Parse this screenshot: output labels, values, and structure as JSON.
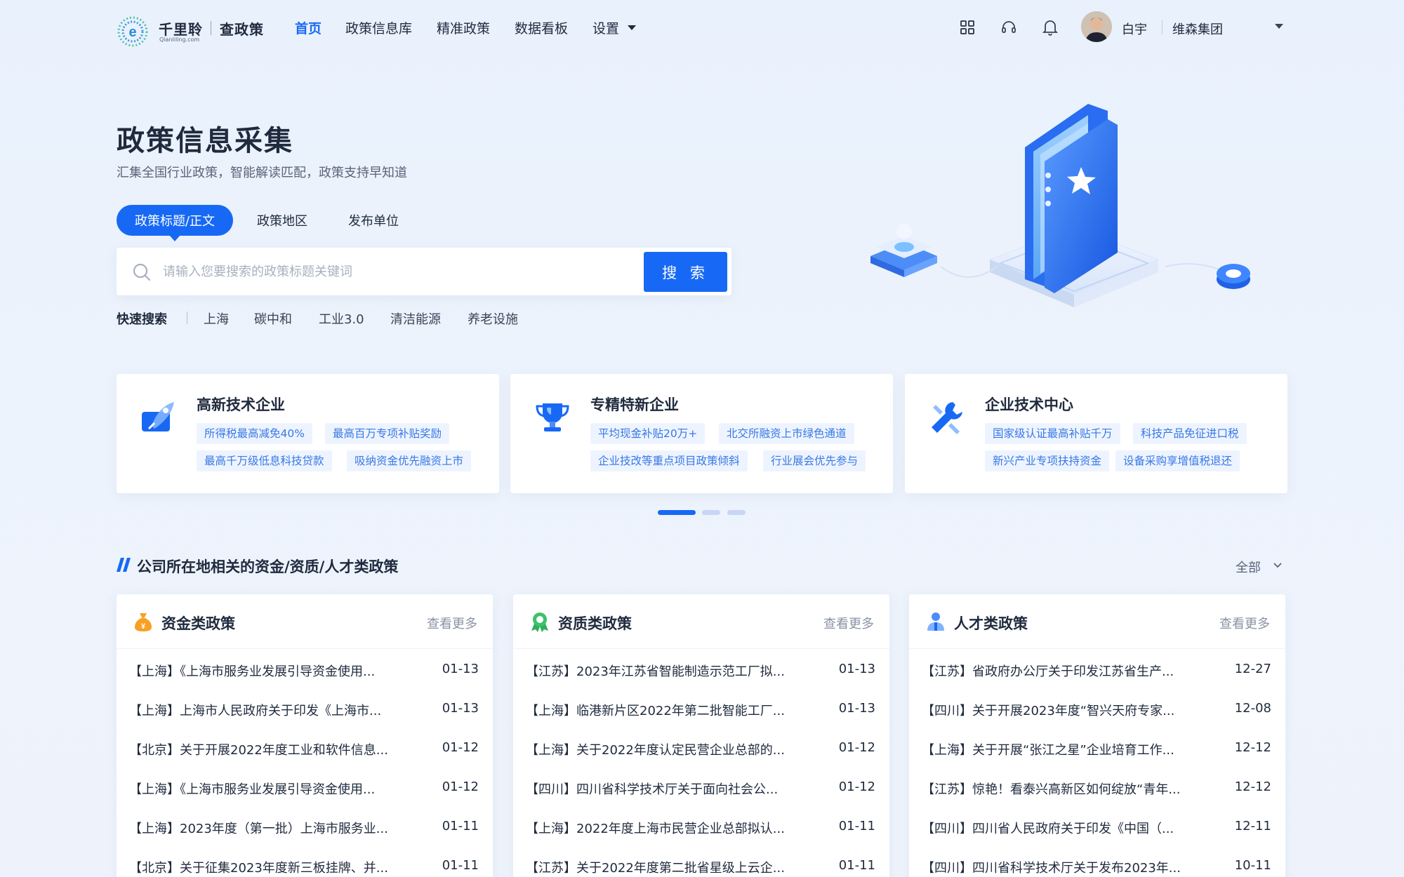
{
  "brand": {
    "name_cn": "千里聆",
    "name_en": "Qianliling.com",
    "product": "查政策"
  },
  "nav": {
    "items": [
      {
        "label": "首页",
        "active": true
      },
      {
        "label": "政策信息库",
        "active": false
      },
      {
        "label": "精准政策",
        "active": false
      },
      {
        "label": "数据看板",
        "active": false
      },
      {
        "label": "设置",
        "active": false
      }
    ]
  },
  "header": {
    "icons": [
      "apps-grid-icon",
      "headset-icon",
      "bell-icon"
    ],
    "user_name": "白宇",
    "org_name": "维森集团"
  },
  "hero": {
    "title": "政策信息采集",
    "subtitle": "汇集全国行业政策，智能解读匹配，政策支持早知道",
    "tabs": [
      {
        "label": "政策标题/正文",
        "active": true
      },
      {
        "label": "政策地区",
        "active": false
      },
      {
        "label": "发布单位",
        "active": false
      }
    ],
    "search_placeholder": "请输入您要搜索的政策标题关键词",
    "search_value": "",
    "search_button": "搜 索",
    "quick_label": "快速搜索",
    "quick_items": [
      "上海",
      "碳中和",
      "工业3.0",
      "清洁能源",
      "养老设施"
    ]
  },
  "feature_cards": [
    {
      "title": "高新技术企业",
      "icon": "rocket-icon",
      "tags": [
        "所得税最高减免40%",
        "最高百万专项补贴奖励",
        "最高千万级低息科技贷款",
        "吸纳资金优先融资上市"
      ]
    },
    {
      "title": "专精特新企业",
      "icon": "trophy-icon",
      "tags": [
        "平均现金补贴20万+",
        "北交所融资上市绿色通道",
        "企业技改等重点项目政策倾斜",
        "行业展会优先参与"
      ]
    },
    {
      "title": "企业技术中心",
      "icon": "wrench-tools-icon",
      "tags": [
        "国家级认证最高补贴千万",
        "科技产品免征进口税",
        "新兴产业专项扶持资金",
        "设备采购享增值税退还"
      ]
    }
  ],
  "carousel": {
    "count": 3,
    "active_index": 0
  },
  "section": {
    "title": "公司所在地相关的资金/资质/人才类政策",
    "filter_label": "全部"
  },
  "policy_cards": [
    {
      "title": "资金类政策",
      "icon": "money-bag-icon",
      "more_label": "查看更多",
      "rows": [
        {
          "title": "【上海】《上海市服务业发展引导资金使用...",
          "date": "01-13"
        },
        {
          "title": "【上海】上海市人民政府关于印发《上海市...",
          "date": "01-13"
        },
        {
          "title": "【北京】关于开展2022年度工业和软件信息...",
          "date": "01-12"
        },
        {
          "title": "【上海】《上海市服务业发展引导资金使用...",
          "date": "01-12"
        },
        {
          "title": "【上海】2023年度（第一批）上海市服务业...",
          "date": "01-11"
        },
        {
          "title": "【北京】关于征集2023年度新三板挂牌、并...",
          "date": "01-11"
        }
      ]
    },
    {
      "title": "资质类政策",
      "icon": "award-badge-icon",
      "more_label": "查看更多",
      "rows": [
        {
          "title": "【江苏】2023年江苏省智能制造示范工厂拟...",
          "date": "01-13"
        },
        {
          "title": "【上海】临港新片区2022年第二批智能工厂...",
          "date": "01-13"
        },
        {
          "title": "【上海】关于2022年度认定民营企业总部的...",
          "date": "01-12"
        },
        {
          "title": "【四川】四川省科学技术厅关于面向社会公...",
          "date": "01-12"
        },
        {
          "title": "【上海】2022年度上海市民营企业总部拟认...",
          "date": "01-11"
        },
        {
          "title": "【江苏】关于2022年度第二批省星级上云企...",
          "date": "01-11"
        }
      ]
    },
    {
      "title": "人才类政策",
      "icon": "people-icon",
      "more_label": "查看更多",
      "rows": [
        {
          "title": "【江苏】省政府办公厅关于印发江苏省生产...",
          "date": "12-27"
        },
        {
          "title": "【四川】关于开展2023年度“智兴天府专家...",
          "date": "12-08"
        },
        {
          "title": "【上海】关于开展“张江之星”企业培育工作...",
          "date": "12-12"
        },
        {
          "title": "【江苏】惊艳！看泰兴高新区如何绽放“青年...",
          "date": "12-12"
        },
        {
          "title": "【四川】四川省人民政府关于印发《中国（...",
          "date": "12-11"
        },
        {
          "title": "【四川】四川省科学技术厅关于发布2023年...",
          "date": "10-11"
        }
      ]
    }
  ],
  "colors": {
    "primary": "#1769f5",
    "tag_text": "#3778e5",
    "tag_bg": "#eef4ff",
    "page_bg": "#e9f1fd",
    "text": "#1f2a3d",
    "muted": "#8a93a5"
  }
}
